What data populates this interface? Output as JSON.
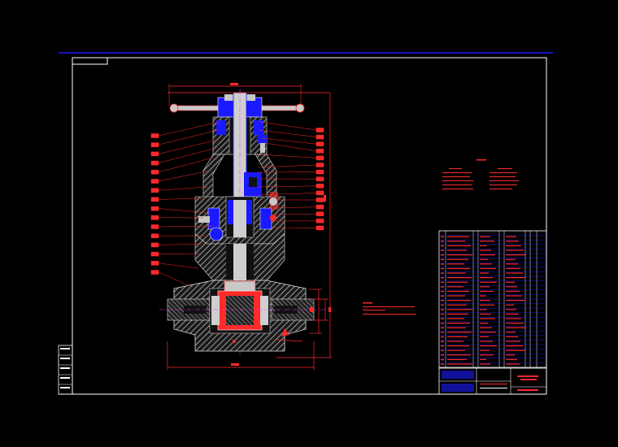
{
  "colors": {
    "background": "#000000",
    "frame": "#ffffff",
    "accent_line": "#1a1aff",
    "red": "#ff2a2a",
    "blue": "#2a2aff",
    "steel": "#c8c8c8",
    "magenta": "#ff33ff",
    "cyan": "#66ffff"
  },
  "icons": {
    "valve_drawing": "gate-valve-section-icon"
  },
  "drawing": {
    "part_count_left": 16,
    "part_count_right": 15,
    "bom_rows": 30
  }
}
